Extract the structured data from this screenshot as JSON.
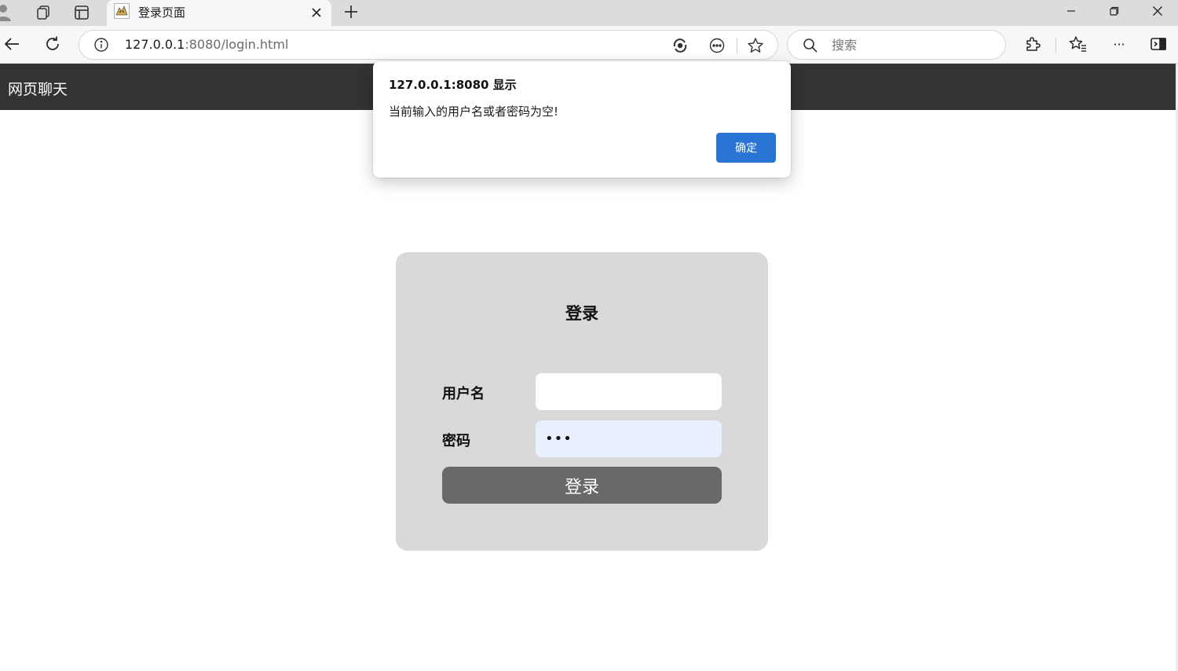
{
  "browser": {
    "tab": {
      "title": "登录页面",
      "close_glyph": "×",
      "favicon": "tomcat-icon"
    },
    "new_tab_glyph": "+",
    "address_bar": {
      "host": "127.0.0.1",
      "path": ":8080/login.html"
    },
    "search": {
      "placeholder": "搜索"
    },
    "icons": [
      "profile-icon",
      "workspaces-icon",
      "tab-actions-icon",
      "back-icon",
      "refresh-icon",
      "site-info-icon",
      "edge-sync-icon",
      "reading-mode-icon",
      "favorite-star-icon",
      "search-icon",
      "extensions-icon",
      "favorites-icon",
      "more-icon",
      "sidebar-icon",
      "minimize-icon",
      "restore-icon",
      "close-window-icon"
    ],
    "more_glyph": "···"
  },
  "navbar": {
    "brand": "网页聊天"
  },
  "login_form": {
    "title": "登录",
    "username_label": "用户名",
    "username_value": "",
    "password_label": "密码",
    "password_value": "•••",
    "submit_label": "登录"
  },
  "alert": {
    "title": "127.0.0.1:8080 显示",
    "message": "当前输入的用户名或者密码为空!",
    "ok_label": "确定"
  },
  "colors": {
    "navbar": "#333333",
    "card": "#d9d9d9",
    "submit_button": "#696969",
    "password_autofill": "#e8f0fe",
    "dialog_button": "#2a74d6"
  }
}
